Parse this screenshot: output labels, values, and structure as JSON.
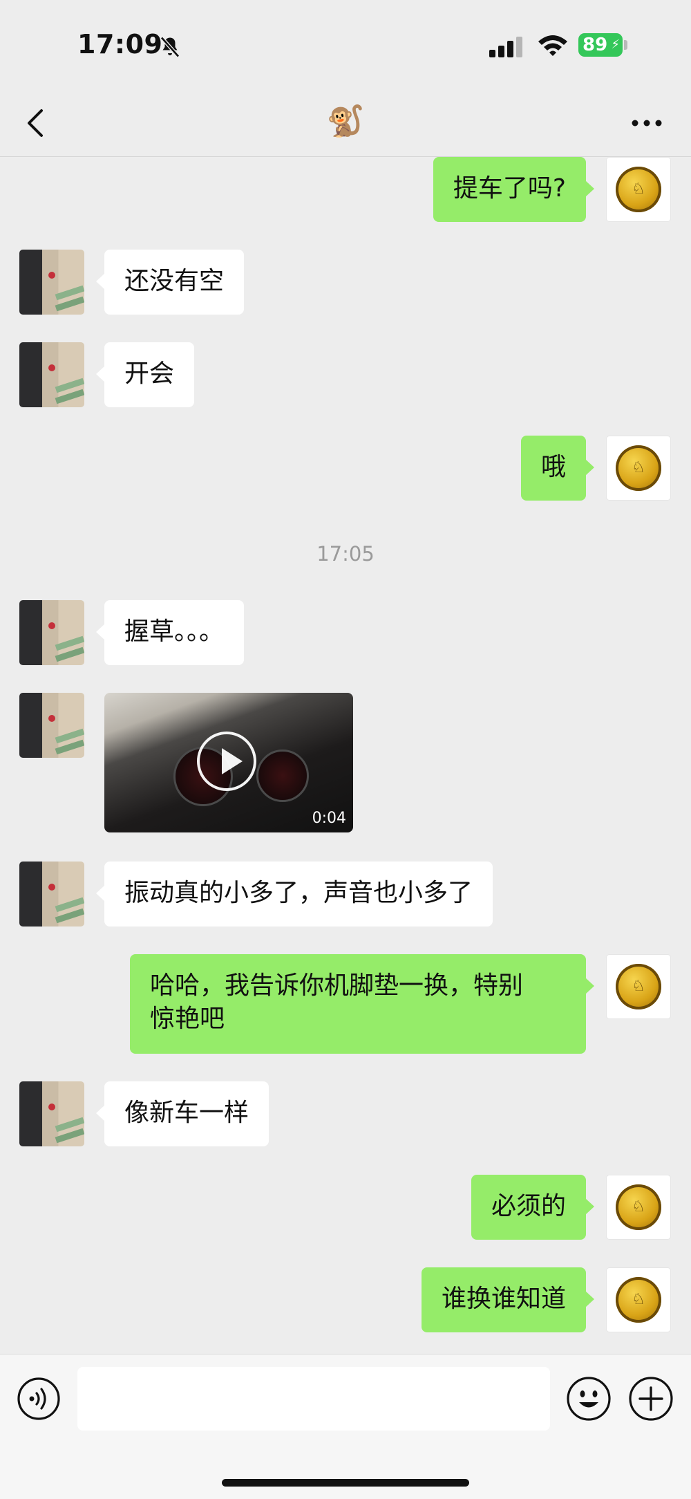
{
  "status_bar": {
    "time": "17:09",
    "battery": "89"
  },
  "nav": {
    "title_emoji": "🐒"
  },
  "messages": [
    {
      "side": "right",
      "text": "提车了吗?"
    },
    {
      "side": "left",
      "text": "还没有空"
    },
    {
      "side": "left",
      "text": "开会"
    },
    {
      "side": "right",
      "text": "哦"
    },
    {
      "timestamp": "17:05"
    },
    {
      "side": "left",
      "text": "握草。。。"
    },
    {
      "side": "left",
      "type": "video",
      "duration": "0:04"
    },
    {
      "side": "left",
      "text": "振动真的小多了，声音也小多了"
    },
    {
      "side": "right",
      "text": "哈哈，我告诉你机脚垫一换，特别\n惊艳吧"
    },
    {
      "side": "left",
      "text": "像新车一样"
    },
    {
      "side": "right",
      "text": "必须的"
    },
    {
      "side": "right",
      "text": "谁换谁知道"
    }
  ],
  "input": {
    "value": "",
    "placeholder": ""
  },
  "colors": {
    "sent_bubble": "#95ec69",
    "received_bubble": "#ffffff",
    "chat_background": "#ededed",
    "battery": "#34c759"
  },
  "icons": {
    "mute": "bell-slash-icon",
    "signal": "cellular-signal-icon",
    "wifi": "wifi-icon",
    "back": "chevron-left-icon",
    "more": "ellipsis-icon",
    "voice": "voice-icon",
    "emoji": "emoji-icon",
    "plus": "plus-icon",
    "play": "play-icon"
  }
}
